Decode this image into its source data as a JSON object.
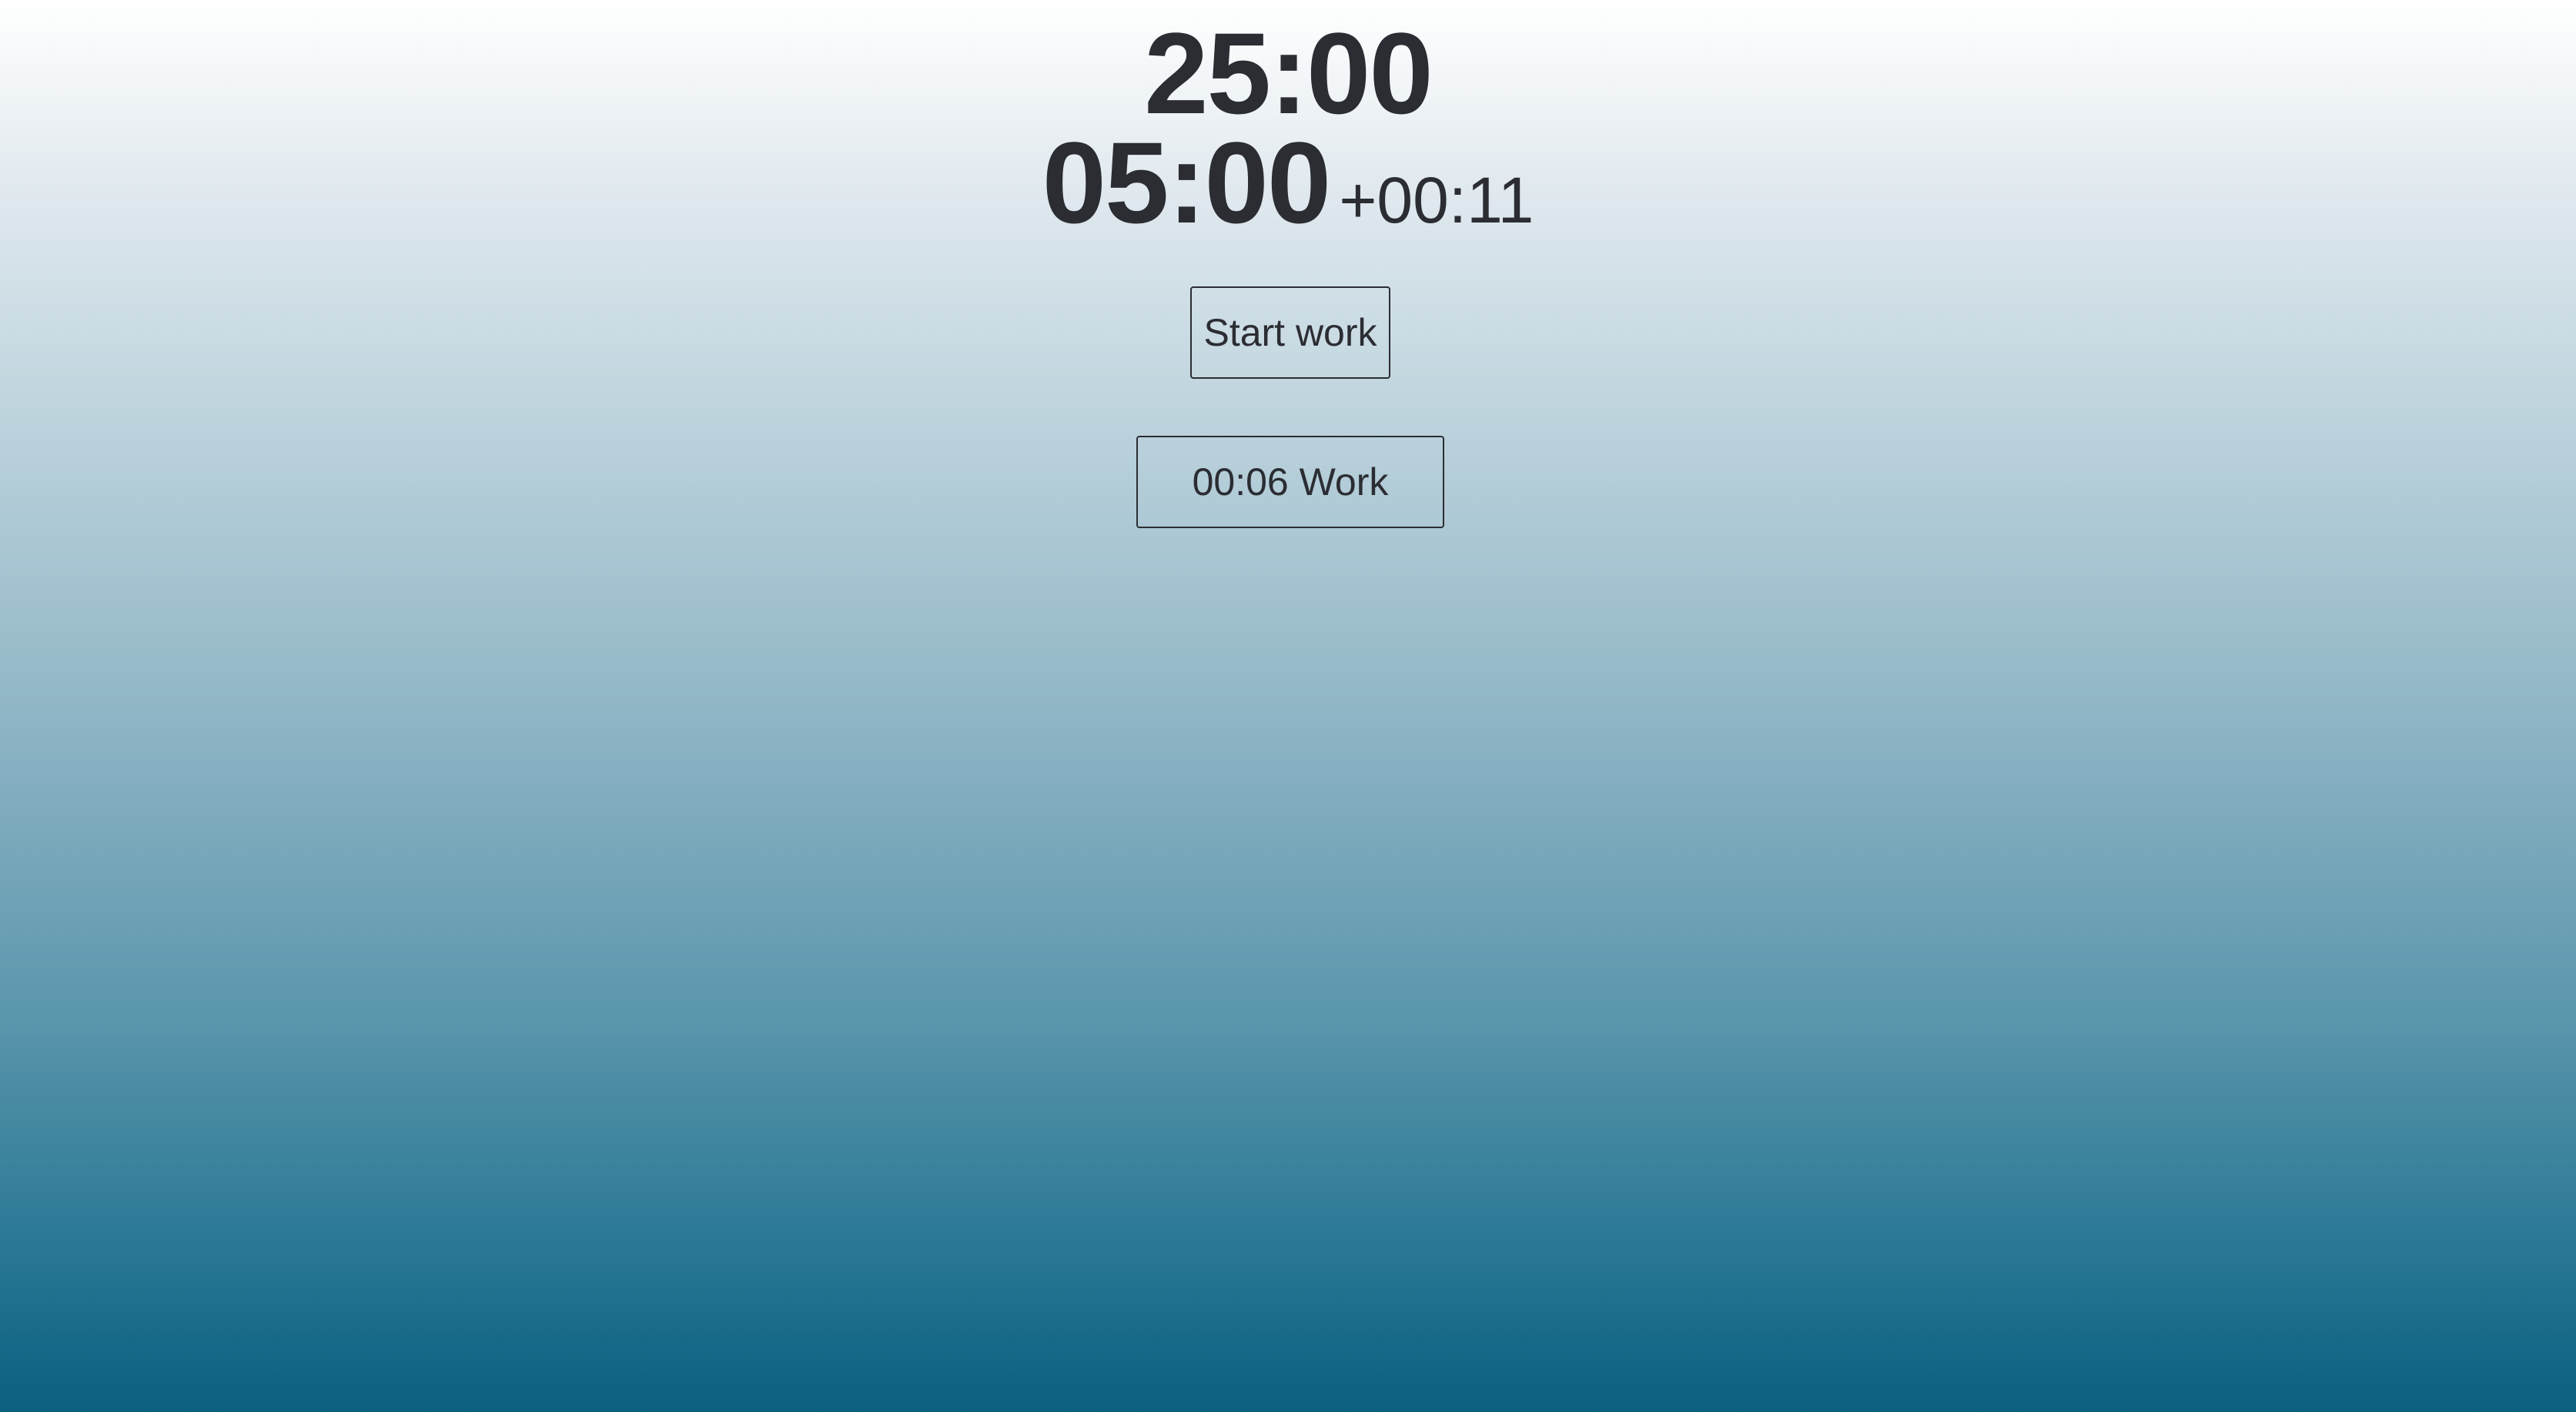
{
  "timers": {
    "work_time": "25:00",
    "break_time": "05:00",
    "extra_time": "+00:11"
  },
  "controls": {
    "start_label": "Start work",
    "session_label": "00:06 Work"
  },
  "colors": {
    "text": "#2b2d33",
    "gradient_top": "#ffffff",
    "gradient_bottom": "#0b5f80"
  }
}
